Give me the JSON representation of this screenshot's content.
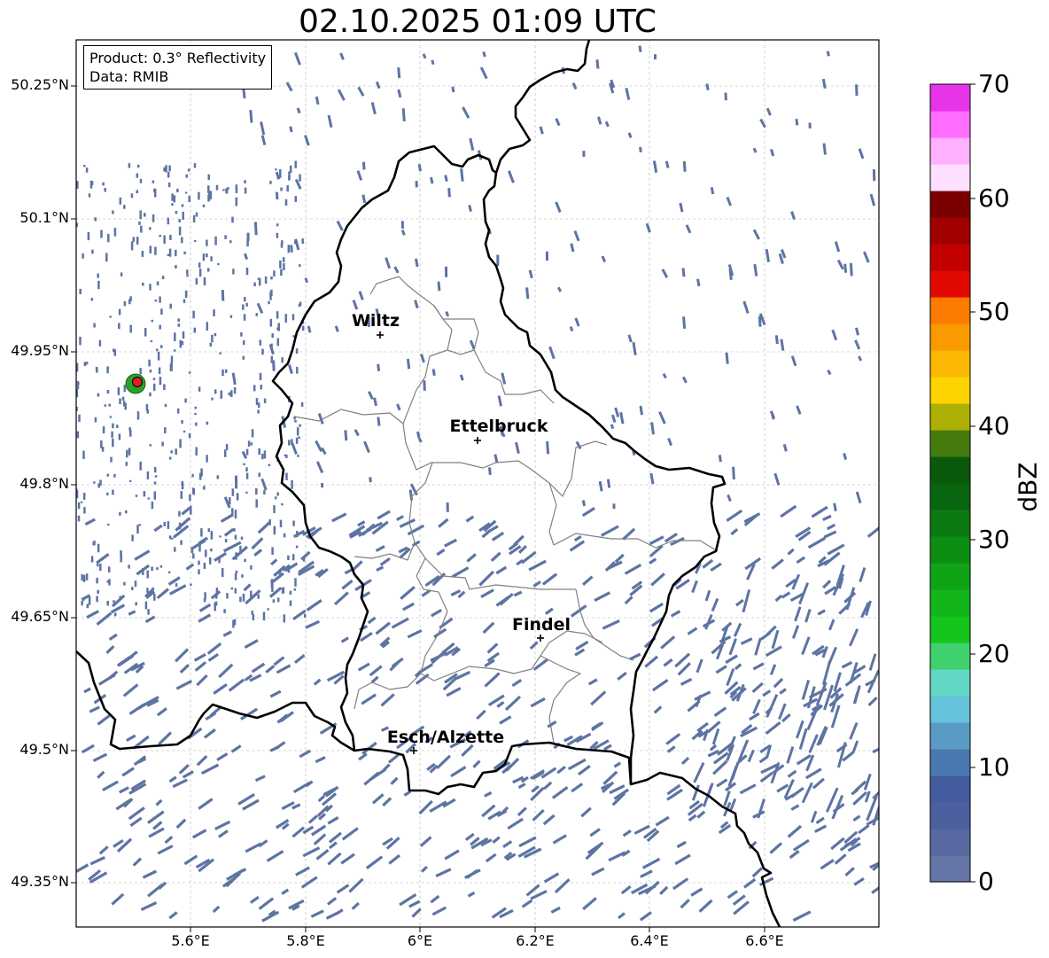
{
  "title": "02.10.2025 01:09 UTC",
  "info": {
    "product": "Product: 0.3° Reflectivity",
    "data": "Data: RMIB"
  },
  "lat_labels": [
    "50.25°N",
    "50.1°N",
    "49.95°N",
    "49.8°N",
    "49.65°N",
    "49.5°N",
    "49.35°N"
  ],
  "lon_labels": [
    "5.6°E",
    "5.8°E",
    "6°E",
    "6.2°E",
    "6.4°E",
    "6.6°E"
  ],
  "cities": [
    {
      "name": "Wiltz"
    },
    {
      "name": "Ettelbruck"
    },
    {
      "name": "Findel"
    },
    {
      "name": "Esch/Alzette"
    }
  ],
  "colorbar": {
    "label": "dBZ",
    "ticks": [
      "70",
      "60",
      "50",
      "40",
      "30",
      "20",
      "10",
      "0"
    ],
    "range": [
      0,
      70
    ],
    "step": 2.5,
    "colors": [
      "#6676a6",
      "#5868a0",
      "#4c5f9e",
      "#435c9f",
      "#4a78b1",
      "#5a9bc6",
      "#66c1da",
      "#62d8c4",
      "#3fd16e",
      "#14c51c",
      "#12b51a",
      "#10a316",
      "#0c8e12",
      "#0b7a10",
      "#0a6510",
      "#0a590c",
      "#457a0e",
      "#acb004",
      "#fdd300",
      "#fbb800",
      "#fb9a00",
      "#fc7a00",
      "#e20a00",
      "#c20000",
      "#a00000",
      "#7a0000",
      "#ffdfff",
      "#ffb0ff",
      "#ff6dff",
      "#e933e9"
    ]
  },
  "colors": {
    "border": "#000000",
    "canton": "#808080",
    "echo": "#5d74a3",
    "grid": "#b0b0b0"
  }
}
